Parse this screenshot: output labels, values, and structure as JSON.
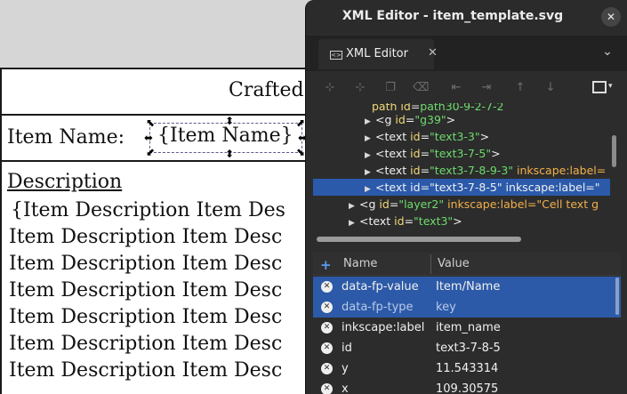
{
  "canvas": {
    "title_partial": "Crafted",
    "name_label": "Item Name:",
    "name_value": "{Item Name}",
    "desc_heading": "Description",
    "desc_lines": [
      "{Item Description Item Des",
      "Item Description Item Desc",
      "Item Description Item Desc",
      "Item Description Item Desc",
      "Item Description Item Desc",
      "Item Description Item Desc",
      "Item Description Item Desc"
    ]
  },
  "dialog": {
    "title": "XML Editor - item_template.svg",
    "close_icon": "close-icon",
    "tab_label": "XML Editor",
    "tab_icon_glyph": "<>",
    "tree": {
      "rows": [
        {
          "indent": 3,
          "caret": "",
          "tag": "",
          "attrs": [
            {
              "k": "path id",
              "v": "path30-9-2-7-2"
            }
          ],
          "partial": true
        },
        {
          "indent": 3,
          "caret": "▶",
          "tag": "g",
          "attrs": [
            {
              "k": "id",
              "v": "g39"
            }
          ]
        },
        {
          "indent": 3,
          "caret": "▶",
          "tag": "text",
          "attrs": [
            {
              "k": "id",
              "v": "text3-3"
            }
          ]
        },
        {
          "indent": 3,
          "caret": "▶",
          "tag": "text",
          "attrs": [
            {
              "k": "id",
              "v": "text3-7-5"
            }
          ]
        },
        {
          "indent": 3,
          "caret": "▶",
          "tag": "text",
          "attrs": [
            {
              "k": "id",
              "v": "text3-7-8-9-3"
            }
          ],
          "extra": "inkscape:label="
        },
        {
          "indent": 3,
          "caret": "▶",
          "tag": "text",
          "attrs": [
            {
              "k": "id",
              "v": "text3-7-8-5"
            }
          ],
          "extra": "inkscape:label=\"",
          "selected": true
        },
        {
          "indent": 2,
          "caret": "▶",
          "tag": "g",
          "attrs": [
            {
              "k": "id",
              "v": "layer2"
            }
          ],
          "extra": "inkscape:label=\"Cell text g"
        },
        {
          "indent": 2,
          "caret": "▶",
          "tag": "text",
          "attrs": [
            {
              "k": "id",
              "v": "text3"
            }
          ]
        }
      ]
    },
    "attributes": {
      "header_name": "Name",
      "header_value": "Value",
      "rows": [
        {
          "name": "data-fp-value",
          "value": "Item/Name",
          "selected": true
        },
        {
          "name": "data-fp-type",
          "value": "key",
          "selected": true,
          "muted": true
        },
        {
          "name": "inkscape:label",
          "value": "item_name"
        },
        {
          "name": "id",
          "value": "text3-7-8-5"
        },
        {
          "name": "y",
          "value": "11.543314"
        },
        {
          "name": "x",
          "value": "109.30575"
        }
      ]
    }
  },
  "colors": {
    "selection": "#2b5aab",
    "attr_value_green": "#6ddc6d",
    "attr_key_yellow": "#f0d878"
  }
}
